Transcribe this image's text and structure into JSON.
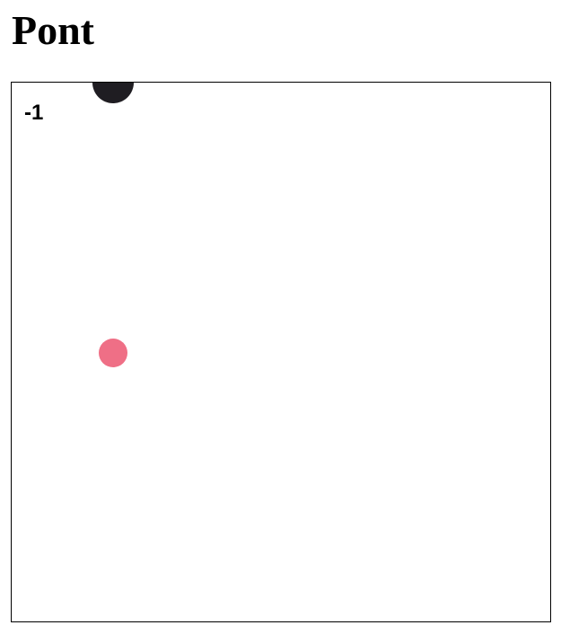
{
  "title": "Pont",
  "game": {
    "score": "-1",
    "paddle": {
      "color": "#1f1d22",
      "shape": "circle"
    },
    "ball": {
      "color": "#ef6f86",
      "shape": "circle"
    },
    "border_color": "#000000",
    "background": "#ffffff"
  }
}
